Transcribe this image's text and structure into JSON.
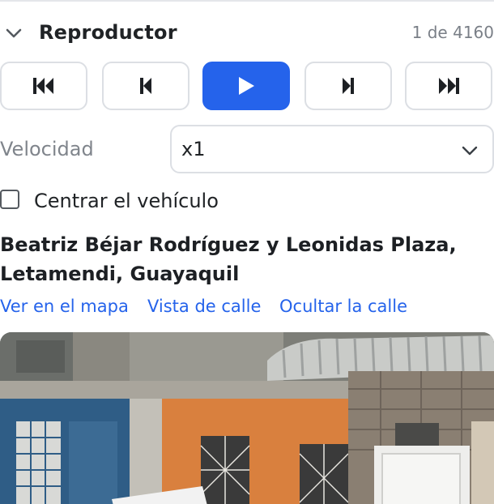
{
  "header": {
    "title": "Reproductor",
    "counter": "1 de 4160",
    "collapse_icon": "chevron-down-icon"
  },
  "controls": [
    {
      "name": "first-button",
      "icon": "skip-to-start-icon",
      "active": false
    },
    {
      "name": "previous-button",
      "icon": "step-back-icon",
      "active": false
    },
    {
      "name": "play-button",
      "icon": "play-icon",
      "active": true
    },
    {
      "name": "next-button",
      "icon": "step-forward-icon",
      "active": false
    },
    {
      "name": "last-button",
      "icon": "skip-to-end-icon",
      "active": false
    }
  ],
  "speed": {
    "label": "Velocidad",
    "value": "x1"
  },
  "center_vehicle": {
    "label": "Centrar el vehículo",
    "checked": false
  },
  "location": {
    "address_line1": "Beatriz Béjar Rodríguez y Leonidas Plaza,",
    "address_line2": "Letamendi, Guayaquil"
  },
  "links": {
    "map": "Ver en el mapa",
    "street_view": "Vista de calle",
    "hide_street": "Ocultar la calle"
  },
  "colors": {
    "accent": "#2563eb",
    "link": "#2563eb",
    "muted_text": "#80858c",
    "border": "#dcdfe4"
  }
}
